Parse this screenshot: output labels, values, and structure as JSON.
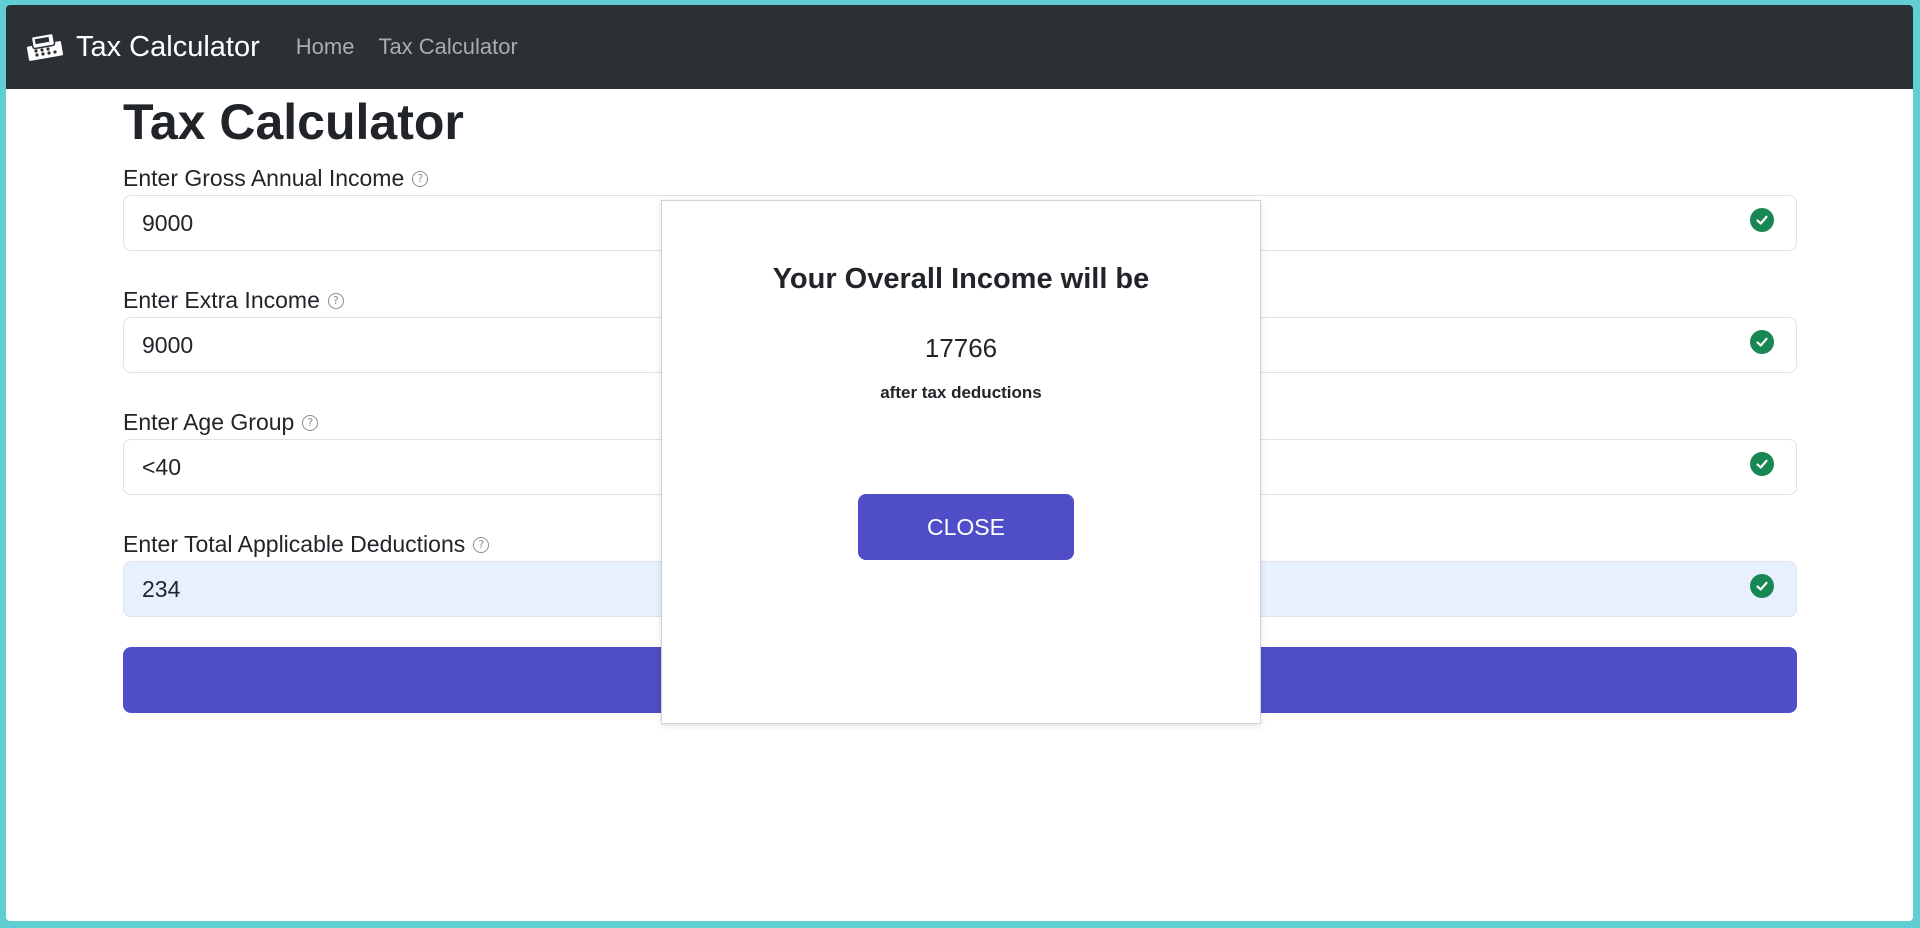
{
  "navbar": {
    "brand": "Tax Calculator",
    "links": [
      "Home",
      "Tax Calculator"
    ]
  },
  "page": {
    "title": "Tax Calculator"
  },
  "form": {
    "fields": [
      {
        "label": "Enter Gross Annual Income",
        "value": "9000",
        "help_icon": "question-circle-icon",
        "status_icon": "check-circle-icon"
      },
      {
        "label": "Enter Extra Income",
        "value": "9000",
        "help_icon": "question-circle-icon",
        "status_icon": "check-circle-icon"
      },
      {
        "label": "Enter Age Group",
        "value": "<40",
        "help_icon": "question-circle-icon",
        "status_icon": "check-circle-icon"
      },
      {
        "label": "Enter Total Applicable Deductions",
        "value": "234",
        "help_icon": "question-circle-icon",
        "status_icon": "check-circle-icon"
      }
    ]
  },
  "modal": {
    "heading": "Your Overall Income will be",
    "amount": "17766",
    "note": "after tax deductions",
    "close_label": "CLOSE"
  },
  "colors": {
    "navbar_bg": "#2b3035",
    "accent": "#4f4ec8",
    "success": "#198754",
    "autofill_bg": "#e8f0fe"
  }
}
